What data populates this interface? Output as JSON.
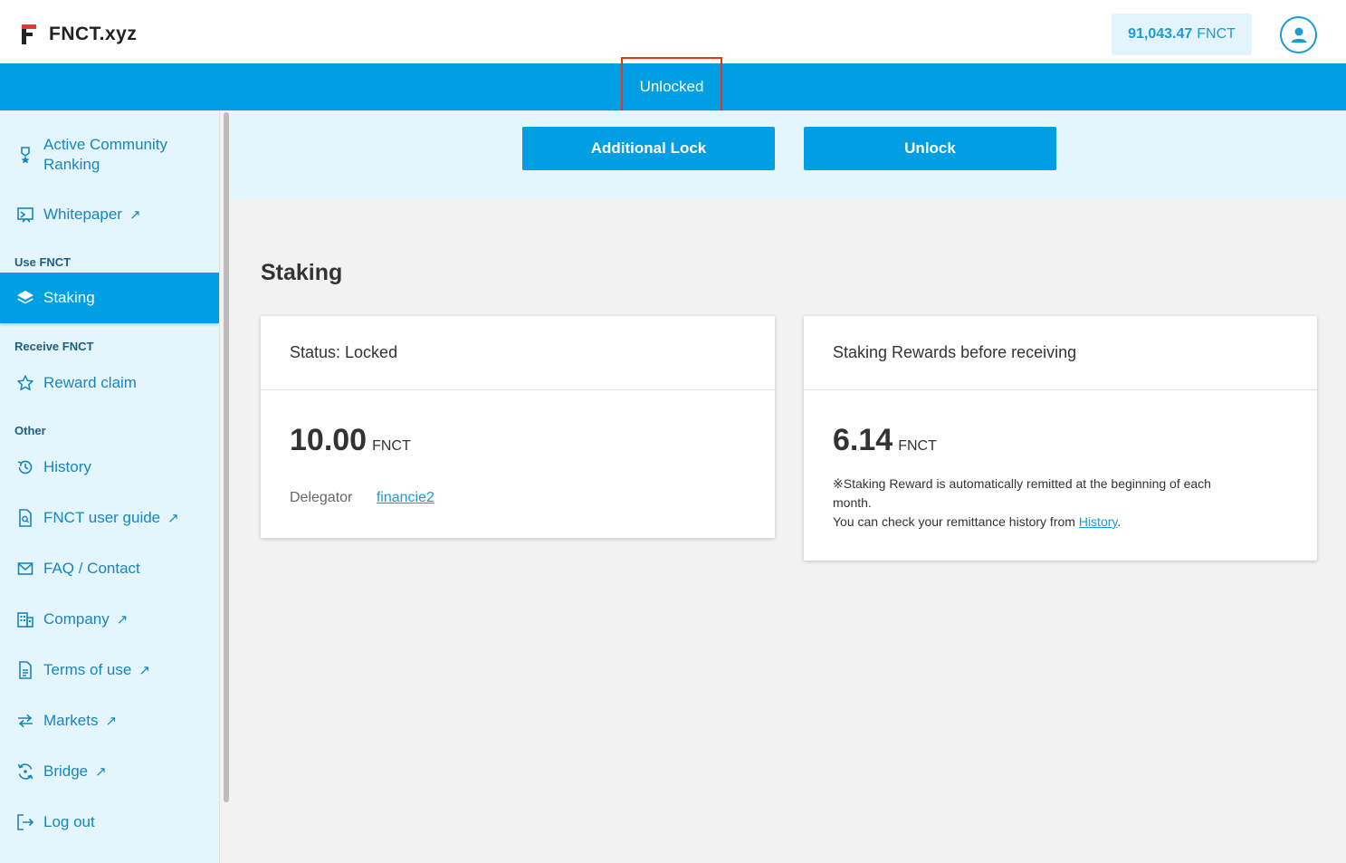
{
  "header": {
    "logo_text": "FNCT.xyz",
    "balance_amount": "91,043.47",
    "balance_unit": "FNCT",
    "avatar_icon": "user-icon"
  },
  "tabs": {
    "active_label": "Unlocked"
  },
  "actions": {
    "additional_lock_label": "Additional Lock",
    "unlock_label": "Unlock"
  },
  "sidebar": {
    "items_top": [
      {
        "label_line1": "Active Community",
        "label_line2": "Ranking",
        "icon": "medal-icon"
      },
      {
        "label": "Whitepaper",
        "icon": "whitepaper-icon",
        "external": "↗"
      }
    ],
    "section_use": "Use FNCT",
    "staking_label": "Staking",
    "section_receive": "Receive FNCT",
    "reward_label": "Reward claim",
    "section_other": "Other",
    "other_items": [
      {
        "label": "History",
        "icon": "history-icon"
      },
      {
        "label": "FNCT user guide",
        "icon": "guide-icon",
        "external": "↗"
      },
      {
        "label": "FAQ / Contact",
        "icon": "mail-icon"
      },
      {
        "label": "Company",
        "icon": "building-icon",
        "external": "↗"
      },
      {
        "label": "Terms of use",
        "icon": "document-icon",
        "external": "↗"
      },
      {
        "label": "Markets",
        "icon": "swap-icon",
        "external": "↗"
      },
      {
        "label": "Bridge",
        "icon": "bridge-icon",
        "external": "↗"
      },
      {
        "label": "Log out",
        "icon": "logout-icon"
      }
    ]
  },
  "main": {
    "title": "Staking",
    "status_card": {
      "heading": "Status: Locked",
      "amount": "10.00",
      "unit": "FNCT",
      "delegator_label": "Delegator",
      "delegator_value": "financie2"
    },
    "rewards_card": {
      "heading": "Staking Rewards before receiving",
      "amount": "6.14",
      "unit": "FNCT",
      "note_line1": "※Staking Reward is automatically remitted at the beginning of each",
      "note_line2": "month.",
      "note_line3_prefix": "You can check your remittance history from ",
      "note_link": "History",
      "note_suffix": "."
    }
  },
  "colors": {
    "accent": "#009fe3",
    "light_accent": "#e5f5fc",
    "highlight_border": "#e53322"
  }
}
